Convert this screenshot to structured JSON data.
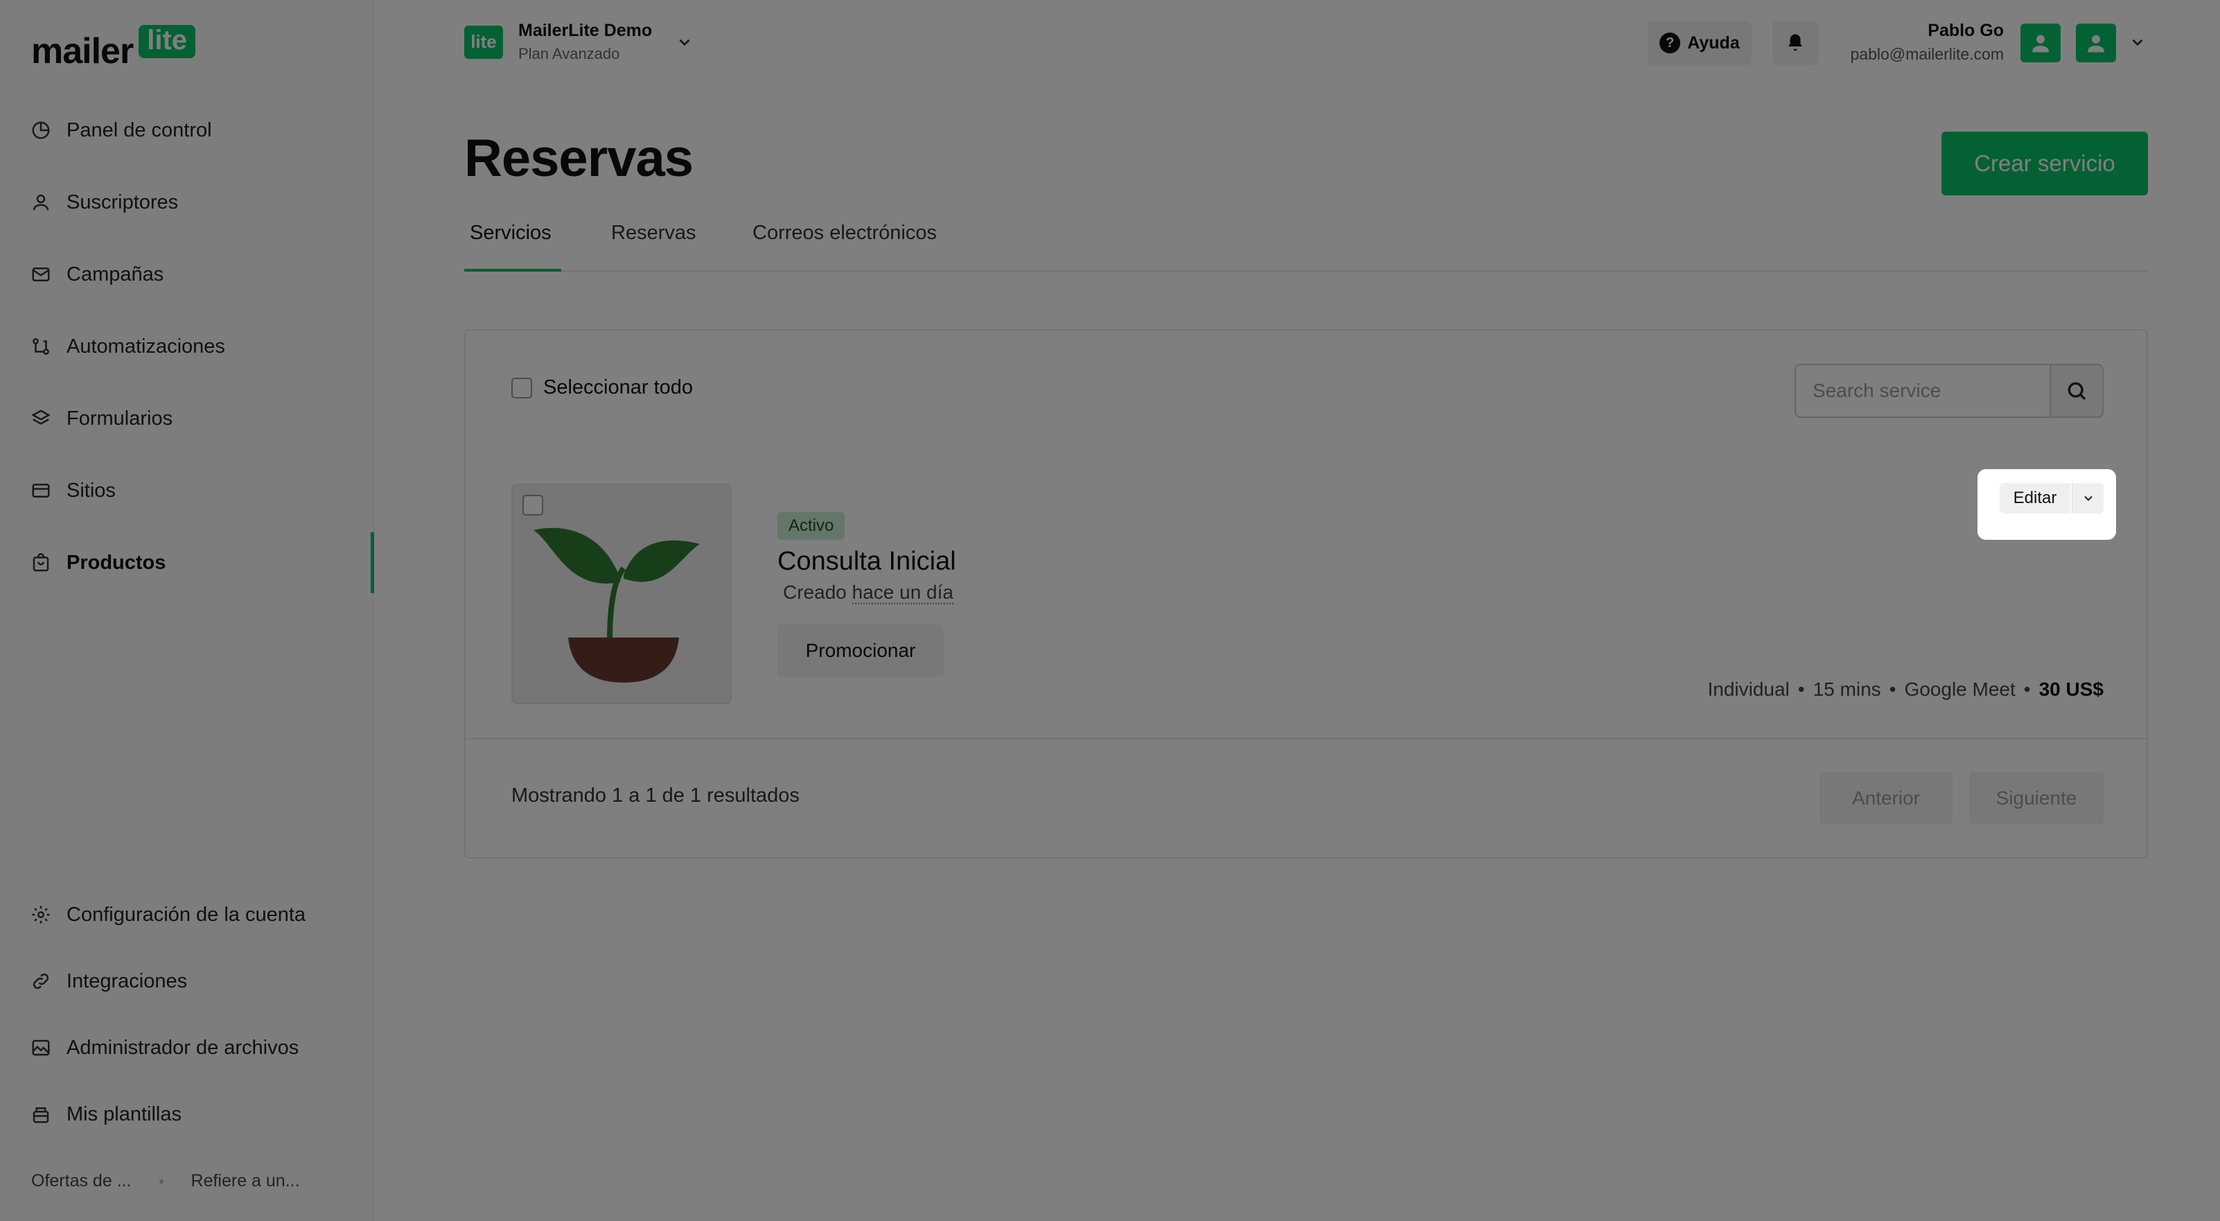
{
  "brand": {
    "word": "mailer",
    "badge": "lite"
  },
  "sidebar": {
    "items": [
      {
        "label": "Panel de control",
        "icon": "clock-icon"
      },
      {
        "label": "Suscriptores",
        "icon": "user-icon"
      },
      {
        "label": "Campañas",
        "icon": "mail-icon"
      },
      {
        "label": "Automatizaciones",
        "icon": "automation-icon"
      },
      {
        "label": "Formularios",
        "icon": "layers-icon"
      },
      {
        "label": "Sitios",
        "icon": "browser-icon"
      },
      {
        "label": "Productos",
        "icon": "bag-icon",
        "active": true
      }
    ],
    "bottom_items": [
      {
        "label": "Configuración de la cuenta",
        "icon": "gear-icon"
      },
      {
        "label": "Integraciones",
        "icon": "link-icon"
      },
      {
        "label": "Administrador de archivos",
        "icon": "image-icon"
      },
      {
        "label": "Mis plantillas",
        "icon": "template-icon"
      }
    ],
    "footer": {
      "left": "Ofertas de ...",
      "right": "Refiere a un..."
    }
  },
  "header": {
    "workspace": {
      "logo": "lite",
      "name": "MailerLite Demo",
      "plan": "Plan Avanzado"
    },
    "help_label": "Ayuda",
    "user": {
      "name": "Pablo Go",
      "email": "pablo@mailerlite.com"
    }
  },
  "page": {
    "title": "Reservas",
    "create_label": "Crear servicio",
    "tabs": [
      "Servicios",
      "Reservas",
      "Correos electrónicos"
    ]
  },
  "list": {
    "select_all": "Seleccionar todo",
    "search_placeholder": "Search service",
    "service": {
      "status": "Activo",
      "title": "Consulta Inicial",
      "created_prefix": "Creado",
      "created_when": "hace un día",
      "promote_label": "Promocionar",
      "edit_label": "Editar",
      "meta": {
        "type": "Individual",
        "duration": "15 mins",
        "location": "Google Meet",
        "price": "30 US$"
      }
    },
    "results_text": "Mostrando 1 a 1 de 1 resultados",
    "prev_label": "Anterior",
    "next_label": "Siguiente"
  },
  "colors": {
    "brand_green": "#09c269",
    "active_badge_bg": "#c9eccf"
  }
}
